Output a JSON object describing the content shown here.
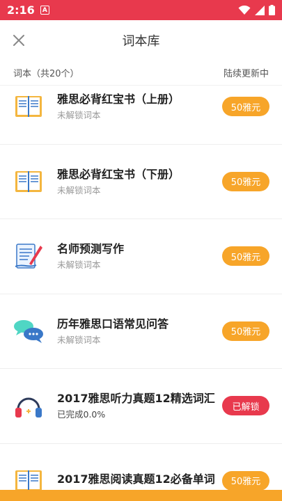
{
  "status": {
    "time": "2:16",
    "app_badge": "A"
  },
  "header": {
    "title": "词本库"
  },
  "subheader": {
    "count_label": "词本（共20个）",
    "right_label": "陆续更新中"
  },
  "books": [
    {
      "title": "雅思必背红宝书（上册）",
      "subtitle": "未解锁词本",
      "button": "50雅元",
      "icon": "book-icon",
      "unlocked": false
    },
    {
      "title": "雅思必背红宝书（下册）",
      "subtitle": "未解锁词本",
      "button": "50雅元",
      "icon": "book-icon",
      "unlocked": false
    },
    {
      "title": "名师预测写作",
      "subtitle": "未解锁词本",
      "button": "50雅元",
      "icon": "quill-paper-icon",
      "unlocked": false
    },
    {
      "title": "历年雅思口语常见问答",
      "subtitle": "未解锁词本",
      "button": "50雅元",
      "icon": "chat-bubbles-icon",
      "unlocked": false
    },
    {
      "title": "2017雅思听力真题12精选词汇",
      "subtitle": "已完成0.0%",
      "button": "已解锁",
      "icon": "headphones-icon",
      "unlocked": true
    },
    {
      "title": "2017雅思阅读真题12必备单词",
      "subtitle": "",
      "button": "50雅元",
      "icon": "book-icon",
      "unlocked": false
    }
  ],
  "colors": {
    "status_bar": "#e8394d",
    "accent_orange": "#f7a529",
    "unlocked_red": "#e8394d"
  }
}
